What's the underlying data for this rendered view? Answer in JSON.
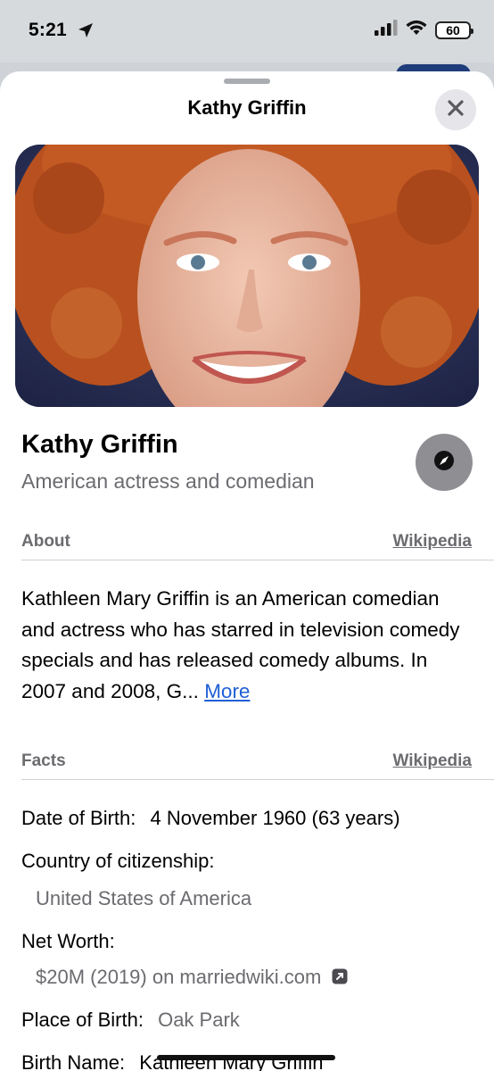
{
  "status": {
    "time": "5:21",
    "battery": "60"
  },
  "sheet": {
    "title": "Kathy Griffin"
  },
  "entity": {
    "name": "Kathy Griffin",
    "description": "American actress and comedian"
  },
  "about": {
    "label": "About",
    "source": "Wikipedia",
    "text": "Kathleen Mary Griffin is an American comedian and actress who has starred in television comedy specials and has released comedy albums. In 2007 and 2008, G...",
    "more": "More"
  },
  "facts": {
    "label": "Facts",
    "source": "Wikipedia",
    "dob_label": "Date of Birth:",
    "dob_value": "4 November 1960 (63 years)",
    "citizenship_label": "Country of citizenship:",
    "citizenship_value": "United States of America",
    "networth_label": "Net Worth:",
    "networth_value": "$20M (2019) on marriedwiki.com",
    "pob_label": "Place of Birth:",
    "pob_value": "Oak Park",
    "birthname_label": "Birth Name:",
    "birthname_value": "Kathleen Mary Griffin"
  },
  "icons": [
    "location-arrow-icon",
    "signal-icon",
    "wifi-icon",
    "battery-icon",
    "close-icon",
    "compass-icon",
    "external-link-icon"
  ]
}
